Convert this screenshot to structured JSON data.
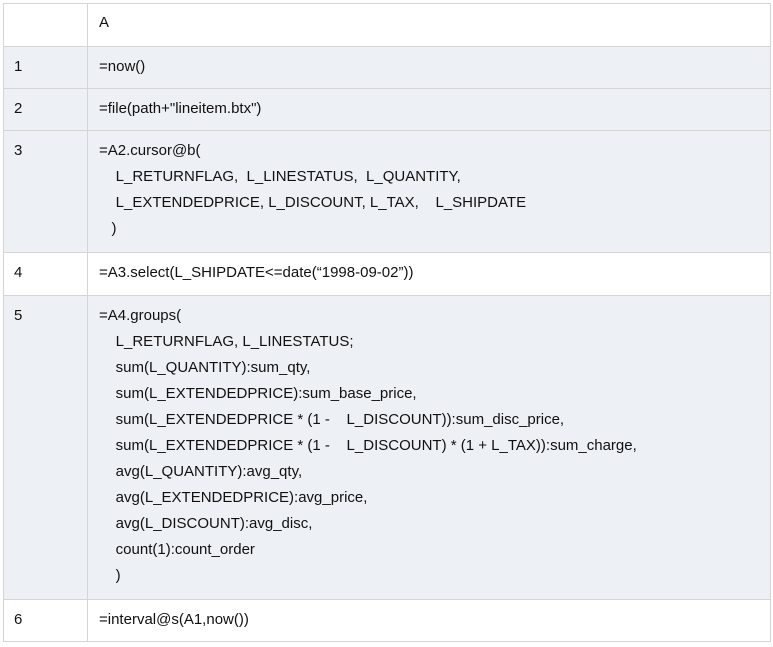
{
  "header": {
    "col_label": "A"
  },
  "rows": [
    {
      "num": "1",
      "lines": [
        "=now()"
      ]
    },
    {
      "num": "2",
      "lines": [
        "=file(path+\"lineitem.btx\")"
      ]
    },
    {
      "num": "3",
      "lines": [
        "=A2.cursor@b(",
        "    L_RETURNFLAG,  L_LINESTATUS,  L_QUANTITY,",
        "    L_EXTENDEDPRICE, L_DISCOUNT, L_TAX,    L_SHIPDATE",
        "   )"
      ]
    },
    {
      "num": "4",
      "lines": [
        "=A3.select(L_SHIPDATE<=date(“1998-09-02”))"
      ]
    },
    {
      "num": "5",
      "lines": [
        "=A4.groups(",
        "    L_RETURNFLAG, L_LINESTATUS;",
        "    sum(L_QUANTITY):sum_qty,",
        "    sum(L_EXTENDEDPRICE):sum_base_price,",
        "    sum(L_EXTENDEDPRICE * (1 -    L_DISCOUNT)):sum_disc_price,",
        "    sum(L_EXTENDEDPRICE * (1 -    L_DISCOUNT) * (1 + L_TAX)):sum_charge,",
        "    avg(L_QUANTITY):avg_qty,",
        "    avg(L_EXTENDEDPRICE):avg_price,",
        "    avg(L_DISCOUNT):avg_disc,",
        "    count(1):count_order",
        "    )"
      ]
    },
    {
      "num": "6",
      "lines": [
        "=interval@s(A1,now())"
      ]
    }
  ]
}
